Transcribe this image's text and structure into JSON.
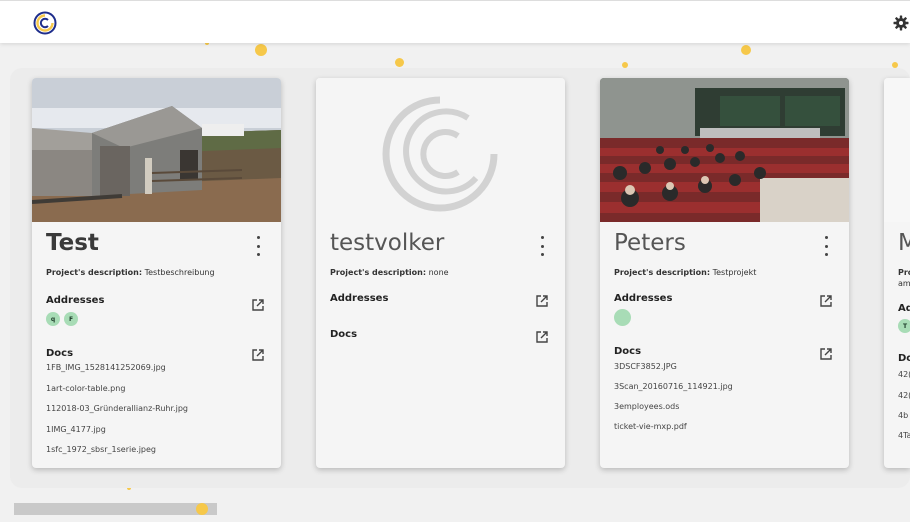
{
  "header": {
    "logo_icon": "app-logo-icon",
    "settings_icon": "gear-icon"
  },
  "labels": {
    "description_prefix": "Project's description:",
    "addresses": "Addresses",
    "docs": "Docs"
  },
  "cards": [
    {
      "title": "Test",
      "description": "Testbeschreibung",
      "addresses": [
        "q",
        "F"
      ],
      "docs": [
        "1FB_IMG_1528141252069.jpg",
        "1art-color-table.png",
        "112018-03_Gründerallianz-Ruhr.jpg",
        "1IMG_4177.jpg",
        "1sfc_1972_sbsr_1serie.jpeg"
      ]
    },
    {
      "title": "testvolker",
      "description": "none",
      "addresses": [],
      "docs": []
    },
    {
      "title": "Peters",
      "description": "Testprojekt",
      "addresses": [
        ""
      ],
      "docs": [
        "3DSCF3852.JPG",
        "3Scan_20160716_114921.jpg",
        "3employees.ods",
        "ticket-vie-mxp.pdf"
      ]
    },
    {
      "title": "M",
      "description_partial": "Pro",
      "description_partial_2": "am",
      "addresses_partial": "Ad",
      "badge": "T",
      "docs_partial": "Do",
      "docs": [
        "42(",
        "42(",
        "4b",
        "4Ta"
      ]
    }
  ],
  "colors": {
    "accent": "#f6c84a",
    "badge": "#a8dcb6",
    "logo": "#1f2e8c"
  }
}
